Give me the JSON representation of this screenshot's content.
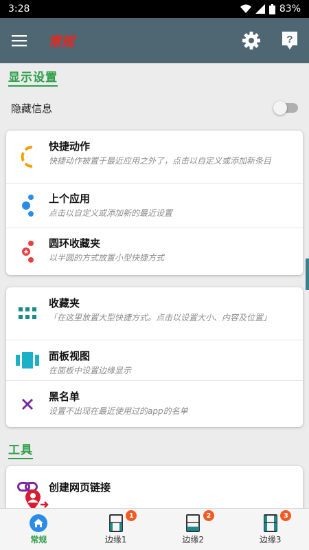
{
  "status": {
    "time": "3:28",
    "battery": "83%"
  },
  "appbar": {
    "title": "常规",
    "title_color": "#e8261e",
    "bg": "#4f6773"
  },
  "sections": {
    "display": "显示设置",
    "tools": "工具"
  },
  "hide_info": {
    "label": "隐藏信息",
    "enabled": false
  },
  "card1": [
    {
      "title": "快捷动作",
      "sub": "快捷动作被置于最近应用之外了，点击以自定义或添加新条目"
    },
    {
      "title": "上个应用",
      "sub": "点击以自定义或添加新的最近设置"
    },
    {
      "title": "圆环收藏夹",
      "sub": "以半圆的方式放置小型快捷方式"
    }
  ],
  "card2": [
    {
      "title": "收藏夹",
      "sub": "「在这里放置大型快捷方式。点击以设置大小、内容及位置」"
    },
    {
      "title": "面板视图",
      "sub": "在面板中设置边缘显示"
    },
    {
      "title": "黑名单",
      "sub": "设置不出现在最近使用过的app的名单"
    }
  ],
  "card3": [
    {
      "title": "创建网页链接"
    }
  ],
  "nav": [
    {
      "label": "常规",
      "active": true
    },
    {
      "label": "边缘1",
      "badge": "1"
    },
    {
      "label": "边缘2",
      "badge": "2"
    },
    {
      "label": "边缘3",
      "badge": "3"
    }
  ]
}
